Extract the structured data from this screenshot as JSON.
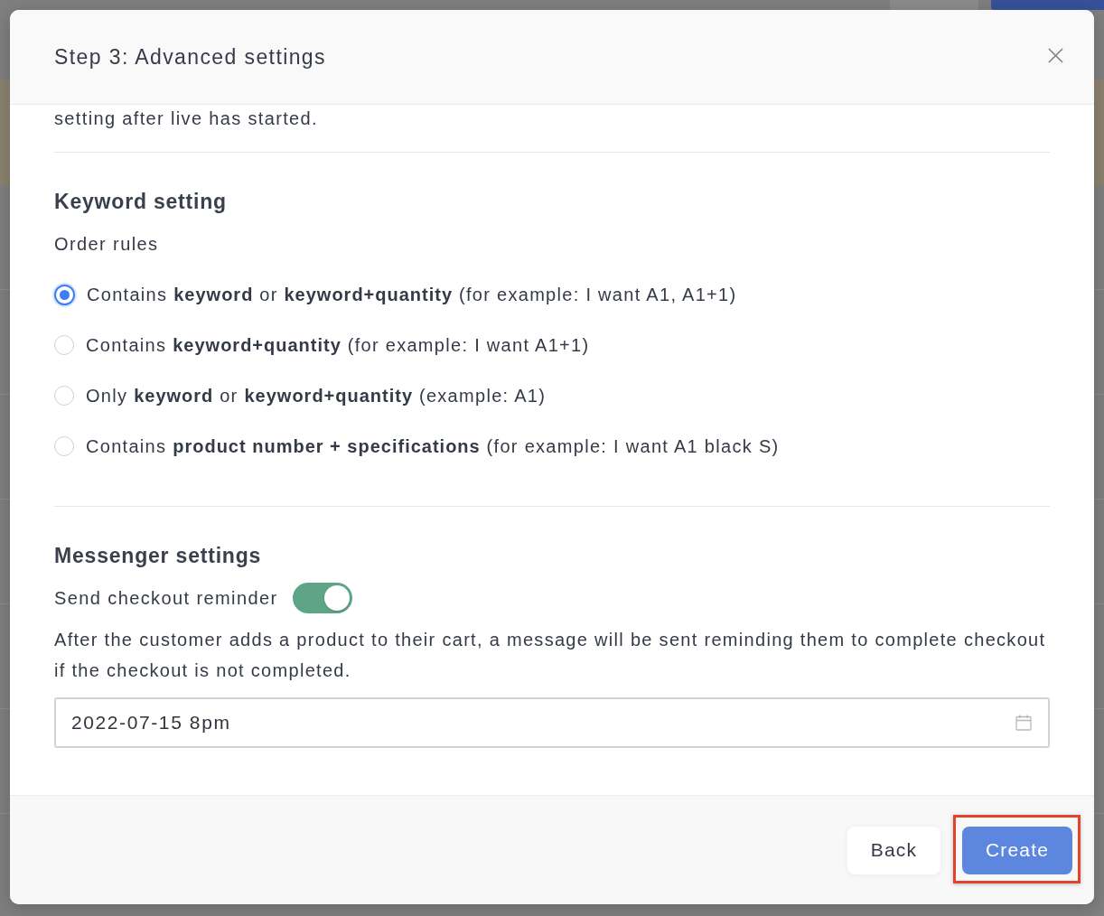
{
  "dialog": {
    "title": "Step 3: Advanced settings",
    "scrolled_text": "setting after live has started."
  },
  "sections": [
    {
      "kind": "keyword",
      "heading": "Keyword setting",
      "label": "Order rules",
      "options": [
        {
          "text": "Contains **keyword** or **keyword+quantity** (for example: I want A1, A1+1)",
          "selected": true
        },
        {
          "text": "Contains **keyword+quantity** (for example: I want A1+1)",
          "selected": false
        },
        {
          "text": "Only **keyword** or **keyword+quantity** (example: A1)",
          "selected": false
        },
        {
          "text": "Contains **product number + specifications** (for example: I want A1 black S)",
          "selected": false
        }
      ]
    },
    {
      "kind": "messenger",
      "heading": "Messenger settings",
      "toggle": {
        "label": "Send checkout reminder",
        "on": true
      },
      "description": "After the customer adds a product to their cart, a message will be sent reminding them to complete checkout if the checkout is not completed.",
      "date_field": {
        "value": "2022-07-15 8pm"
      }
    }
  ],
  "buttons": [
    {
      "label": "Back",
      "kind": "secondary",
      "highlighted": false
    },
    {
      "label": "Create",
      "kind": "primary",
      "highlighted": true
    }
  ]
}
